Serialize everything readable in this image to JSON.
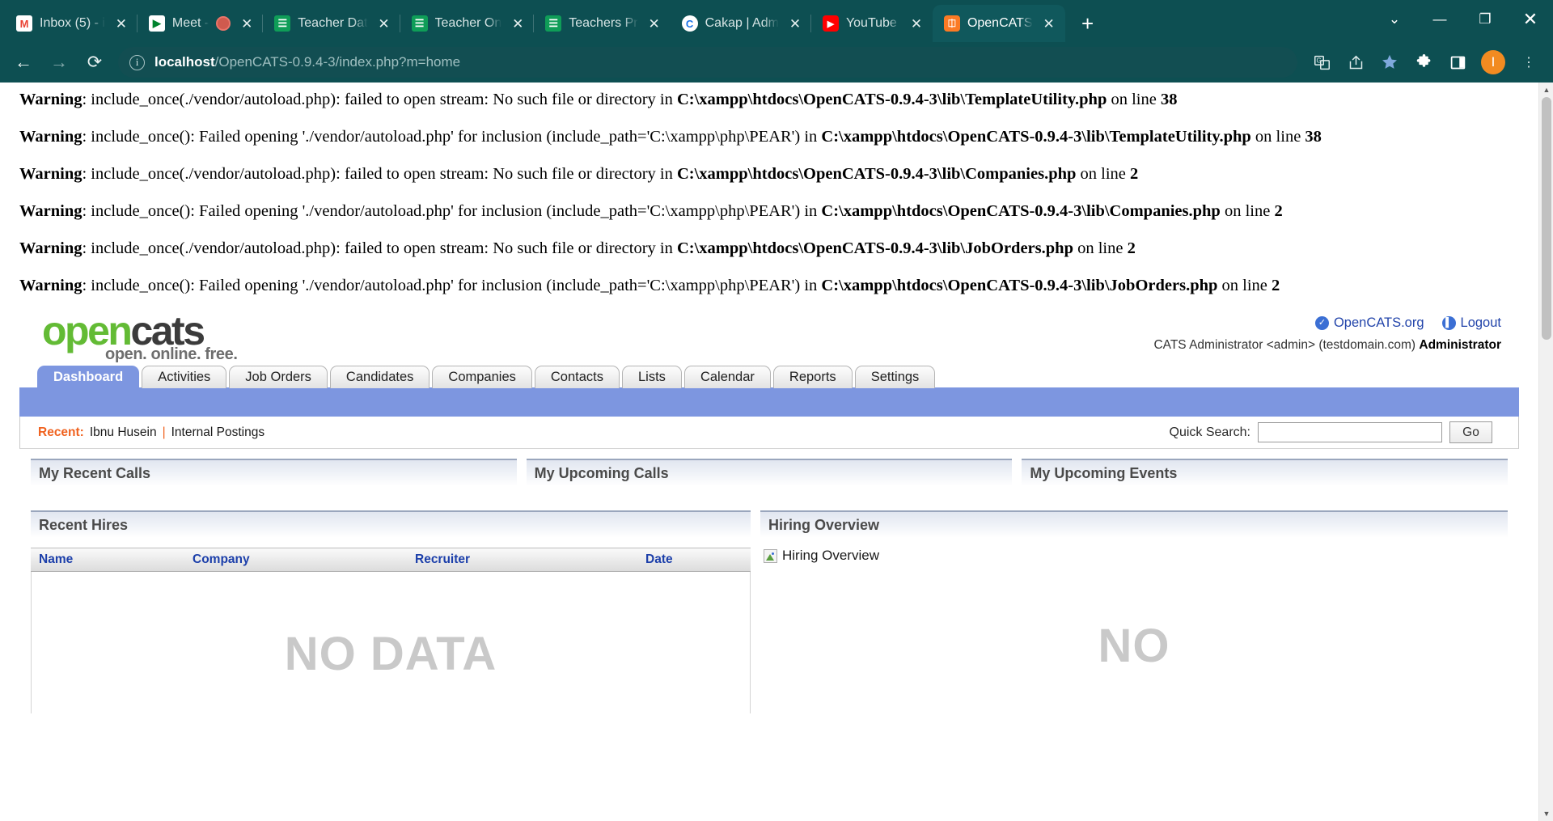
{
  "browser": {
    "tabs": [
      {
        "title": "Inbox (5) - i",
        "favicon": "gmail-icon",
        "glyph": "M",
        "active": false,
        "recording": false
      },
      {
        "title": "Meet - ",
        "favicon": "google-meet-icon",
        "glyph": "▶",
        "active": false,
        "recording": true
      },
      {
        "title": "Teacher Dat",
        "favicon": "google-sheets-icon",
        "glyph": "☷",
        "active": false,
        "recording": false
      },
      {
        "title": "Teacher On",
        "favicon": "google-sheets-icon",
        "glyph": "☷",
        "active": false,
        "recording": false
      },
      {
        "title": "Teachers Pr",
        "favicon": "google-sheets-icon",
        "glyph": "☷",
        "active": false,
        "recording": false
      },
      {
        "title": "Cakap | Adm",
        "favicon": "cakap-icon",
        "glyph": "C",
        "active": false,
        "recording": false
      },
      {
        "title": "YouTube",
        "favicon": "youtube-icon",
        "glyph": "▶",
        "active": false,
        "recording": false
      },
      {
        "title": "OpenCATS",
        "favicon": "xampp-icon",
        "glyph": "⌘",
        "active": true,
        "recording": false
      }
    ],
    "new_tab_label": "+",
    "window_controls": {
      "minimize": "—",
      "maximize": "❐",
      "close": "✕",
      "chevron": "⌄"
    },
    "toolbar": {
      "back": "←",
      "forward": "→",
      "reload": "⟳",
      "url_host": "localhost",
      "url_path": "/OpenCATS-0.9.4-3/index.php?m=home",
      "info_glyph": "i",
      "translate": "translate-icon",
      "share": "share-icon",
      "bookmark": "★",
      "extensions": "extensions-icon",
      "sidepanel": "side-panel-icon",
      "profile_initial": "I",
      "menu": "⋮"
    }
  },
  "warnings": [
    {
      "label": "Warning",
      "text_a": ": include_once(./vendor/autoload.php): failed to open stream: No such file or directory in ",
      "path": "C:\\xampp\\htdocs\\OpenCATS-0.9.4-3\\lib\\TemplateUtility.php",
      "text_b": " on line ",
      "line": "38"
    },
    {
      "label": "Warning",
      "text_a": ": include_once(): Failed opening './vendor/autoload.php' for inclusion (include_path='C:\\xampp\\php\\PEAR') in ",
      "path": "C:\\xampp\\htdocs\\OpenCATS-0.9.4-3\\lib\\TemplateUtility.php",
      "text_b": " on line ",
      "line": "38"
    },
    {
      "label": "Warning",
      "text_a": ": include_once(./vendor/autoload.php): failed to open stream: No such file or directory in ",
      "path": "C:\\xampp\\htdocs\\OpenCATS-0.9.4-3\\lib\\Companies.php",
      "text_b": " on line ",
      "line": "2"
    },
    {
      "label": "Warning",
      "text_a": ": include_once(): Failed opening './vendor/autoload.php' for inclusion (include_path='C:\\xampp\\php\\PEAR') in ",
      "path": "C:\\xampp\\htdocs\\OpenCATS-0.9.4-3\\lib\\Companies.php",
      "text_b": " on line ",
      "line": "2"
    },
    {
      "label": "Warning",
      "text_a": ": include_once(./vendor/autoload.php): failed to open stream: No such file or directory in ",
      "path": "C:\\xampp\\htdocs\\OpenCATS-0.9.4-3\\lib\\JobOrders.php",
      "text_b": " on line ",
      "line": "2"
    },
    {
      "label": "Warning",
      "text_a": ": include_once(): Failed opening './vendor/autoload.php' for inclusion (include_path='C:\\xampp\\php\\PEAR') in ",
      "path": "C:\\xampp\\htdocs\\OpenCATS-0.9.4-3\\lib\\JobOrders.php",
      "text_b": " on line ",
      "line": "2"
    }
  ],
  "app": {
    "logo": {
      "part_open": "open",
      "part_cats": "cats",
      "tagline": "open. online. free."
    },
    "header_links": [
      {
        "label": "OpenCATS.org",
        "icon": "check-circle-icon",
        "glyph": "✓"
      },
      {
        "label": "Logout",
        "icon": "power-icon",
        "glyph": "▌"
      }
    ],
    "user_line": "CATS Administrator <admin> (testdomain.com) ",
    "user_role": "Administrator",
    "tabs": [
      {
        "label": "Dashboard",
        "active": true
      },
      {
        "label": "Activities",
        "active": false
      },
      {
        "label": "Job Orders",
        "active": false
      },
      {
        "label": "Candidates",
        "active": false
      },
      {
        "label": "Companies",
        "active": false
      },
      {
        "label": "Contacts",
        "active": false
      },
      {
        "label": "Lists",
        "active": false
      },
      {
        "label": "Calendar",
        "active": false
      },
      {
        "label": "Reports",
        "active": false
      },
      {
        "label": "Settings",
        "active": false
      }
    ],
    "recent": {
      "label": "Recent:",
      "items": [
        "Ibnu Husein",
        "Internal Postings"
      ],
      "separator": "|"
    },
    "quick_search": {
      "label": "Quick Search:",
      "value": "",
      "placeholder": "",
      "button": "Go"
    },
    "panels_top": [
      {
        "title": "My Recent Calls"
      },
      {
        "title": "My Upcoming Calls"
      },
      {
        "title": "My Upcoming Events"
      }
    ],
    "recent_hires": {
      "title": "Recent Hires",
      "columns": [
        "Name",
        "Company",
        "Recruiter",
        "Date"
      ],
      "rows": [],
      "empty_text": "NO DATA"
    },
    "hiring_overview": {
      "title": "Hiring Overview",
      "broken_image_alt": "Hiring Overview",
      "empty_text": "NO"
    }
  },
  "scrollbar": {
    "up": "▲",
    "down": "▼"
  }
}
